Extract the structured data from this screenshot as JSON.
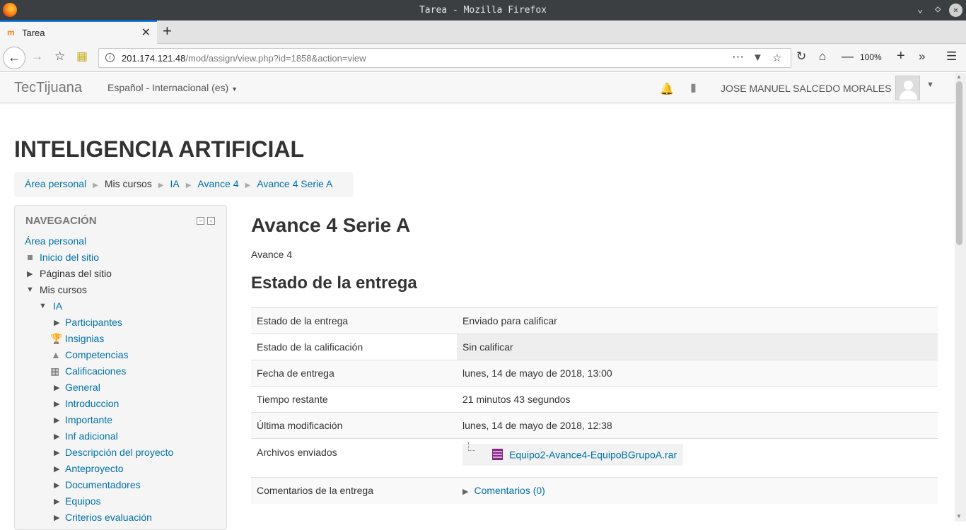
{
  "window": {
    "title": "Tarea - Mozilla Firefox"
  },
  "browser": {
    "tab_title": "Tarea",
    "url_host": "201.174.121.48",
    "url_path": "/mod/assign/view.php?id=1858&action=view",
    "zoom": "100%"
  },
  "moodle_nav": {
    "brand": "TecTijuana",
    "language": "Español - Internacional (es)",
    "user_name": "JOSE MANUEL SALCEDO MORALES"
  },
  "course_title": "INTELIGENCIA ARTIFICIAL",
  "breadcrumb": [
    "Área personal",
    "Mis cursos",
    "IA",
    "Avance 4",
    "Avance 4 Serie A"
  ],
  "navigation": {
    "header": "NAVEGACIÓN",
    "items": [
      {
        "label": "Área personal"
      },
      {
        "label": "Inicio del sitio"
      },
      {
        "label": "Páginas del sitio"
      },
      {
        "label": "Mis cursos"
      },
      {
        "label": "IA"
      },
      {
        "label": "Participantes"
      },
      {
        "label": "Insignias"
      },
      {
        "label": "Competencias"
      },
      {
        "label": "Calificaciones"
      },
      {
        "label": "General"
      },
      {
        "label": "Introduccion"
      },
      {
        "label": "Importante"
      },
      {
        "label": "Inf adicional"
      },
      {
        "label": "Descripción del proyecto"
      },
      {
        "label": "Anteproyecto"
      },
      {
        "label": "Documentadores"
      },
      {
        "label": "Equipos"
      },
      {
        "label": "Criterios evaluación"
      }
    ]
  },
  "main": {
    "title": "Avance 4 Serie A",
    "subtitle": "Avance 4",
    "section_heading": "Estado de la entrega",
    "rows": [
      {
        "label": "Estado de la entrega",
        "value": "Enviado para calificar"
      },
      {
        "label": "Estado de la calificación",
        "value": "Sin calificar"
      },
      {
        "label": "Fecha de entrega",
        "value": "lunes, 14 de mayo de 2018, 13:00"
      },
      {
        "label": "Tiempo restante",
        "value": "21 minutos 43 segundos"
      },
      {
        "label": "Última modificación",
        "value": "lunes, 14 de mayo de 2018, 12:38"
      },
      {
        "label": "Archivos enviados",
        "value": "Equipo2-Avance4-EquipoBGrupoA.rar"
      },
      {
        "label": "Comentarios de la entrega",
        "value": "Comentarios (0)"
      }
    ]
  },
  "icons": [
    "firefox-icon",
    "minimize-icon",
    "maximize-icon",
    "close-icon",
    "moodle-favicon",
    "tab-close-icon",
    "new-tab-icon",
    "back-icon",
    "forward-icon",
    "bookmark-star-icon",
    "library-icon",
    "site-info-icon",
    "page-actions-icon",
    "pocket-icon",
    "star-icon",
    "reload-icon",
    "home-icon",
    "zoom-out-icon",
    "zoom-in-icon",
    "overflow-icon",
    "menu-icon",
    "bell-icon",
    "message-icon",
    "user-avatar",
    "caret-down-icon",
    "folder-icon",
    "file-archive-icon"
  ]
}
